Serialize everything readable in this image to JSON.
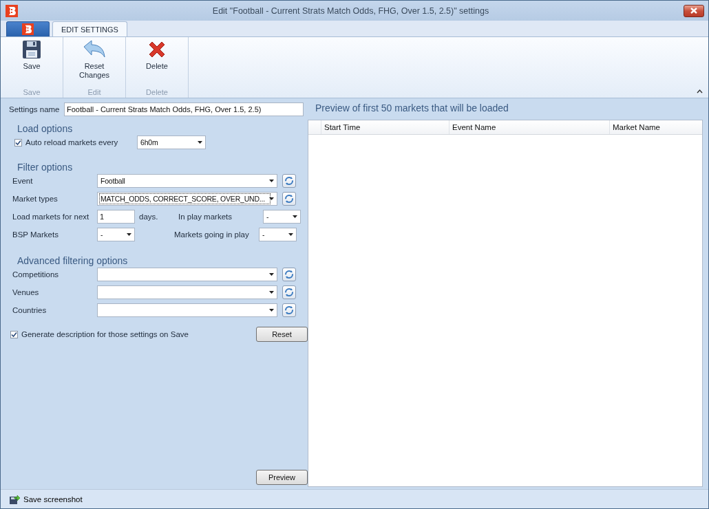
{
  "window": {
    "title": "Edit \"Football - Current Strats Match Odds, FHG, Over 1.5, 2.5)\" settings"
  },
  "ribbon": {
    "tabs": [
      {
        "label": "EDIT SETTINGS",
        "selected": true
      }
    ],
    "groups": [
      {
        "label": "Save",
        "button": {
          "label": "Save",
          "kind": "save"
        }
      },
      {
        "label": "Edit",
        "button": {
          "label": "Reset Changes",
          "kind": "undo"
        }
      },
      {
        "label": "Delete",
        "button": {
          "label": "Delete",
          "kind": "delete"
        }
      }
    ]
  },
  "settings_name": {
    "label": "Settings name",
    "value": "Football - Current Strats Match Odds, FHG, Over 1.5, 2.5)"
  },
  "load_options": {
    "heading": "Load options",
    "auto_reload": {
      "label": "Auto reload markets every",
      "checked": true,
      "value": "6h0m"
    }
  },
  "filter_options": {
    "heading": "Filter options",
    "event": {
      "label": "Event",
      "value": "Football"
    },
    "market_types": {
      "label": "Market types",
      "value": "MATCH_ODDS, CORRECT_SCORE, OVER_UND...",
      "focused": true
    },
    "load_next": {
      "label": "Load markets for next",
      "value": "1",
      "unit": "days."
    },
    "in_play": {
      "label": "In play markets",
      "value": "-"
    },
    "bsp": {
      "label": "BSP Markets",
      "value": "-"
    },
    "going_in_play": {
      "label": "Markets going in play",
      "value": "-"
    }
  },
  "advanced": {
    "heading": "Advanced filtering options",
    "fields": [
      {
        "label": "Competitions"
      },
      {
        "label": "Venues"
      },
      {
        "label": "Countries"
      }
    ]
  },
  "generate_description": {
    "label": "Generate description for those settings on Save",
    "checked": true
  },
  "reset_button": "Reset",
  "preview_button": "Preview",
  "preview": {
    "heading": "Preview of first 50 markets that will be loaded",
    "columns": [
      "Start Time",
      "Event Name",
      "Market Name"
    ]
  },
  "status_bar": {
    "label": "Save screenshot"
  }
}
